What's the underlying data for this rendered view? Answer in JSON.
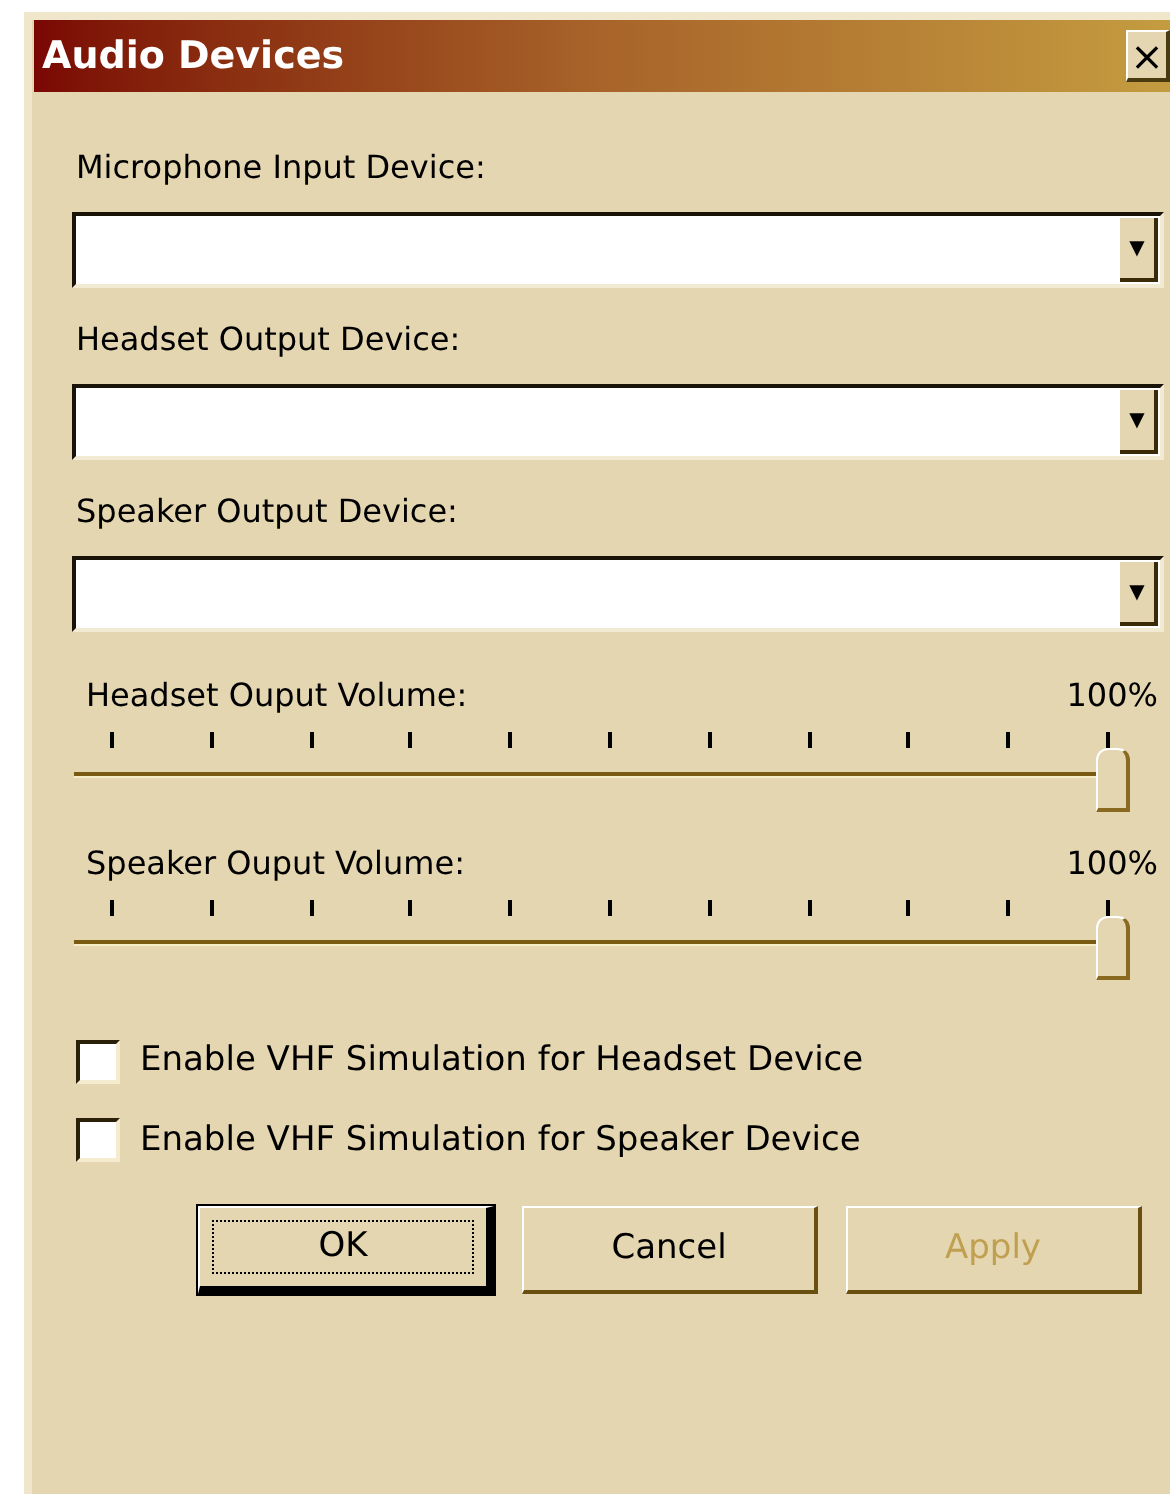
{
  "window": {
    "title": "Audio Devices",
    "close": "×"
  },
  "devices": [
    {
      "label": "Microphone Input Device:",
      "arrow": "▼"
    },
    {
      "label": "Headset Output Device:",
      "arrow": "▼"
    },
    {
      "label": "Speaker Output Device:",
      "arrow": "▼"
    }
  ],
  "volumes": [
    {
      "label": "Headset Ouput Volume:",
      "reading": "100%",
      "level": 1
    },
    {
      "label": "Speaker Ouput Volume:",
      "reading": "100%",
      "level": 1
    }
  ],
  "checkboxes": [
    {
      "label": "Enable VHF Simulation for Headset Device",
      "checked": false
    },
    {
      "label": "Enable VHF Simulation for Speaker Device",
      "checked": false
    }
  ],
  "buttons": [
    {
      "label": "OK",
      "default": true,
      "disabled": false
    },
    {
      "label": "Cancel",
      "default": false,
      "disabled": false
    },
    {
      "label": "Apply",
      "default": false,
      "disabled": true
    }
  ]
}
